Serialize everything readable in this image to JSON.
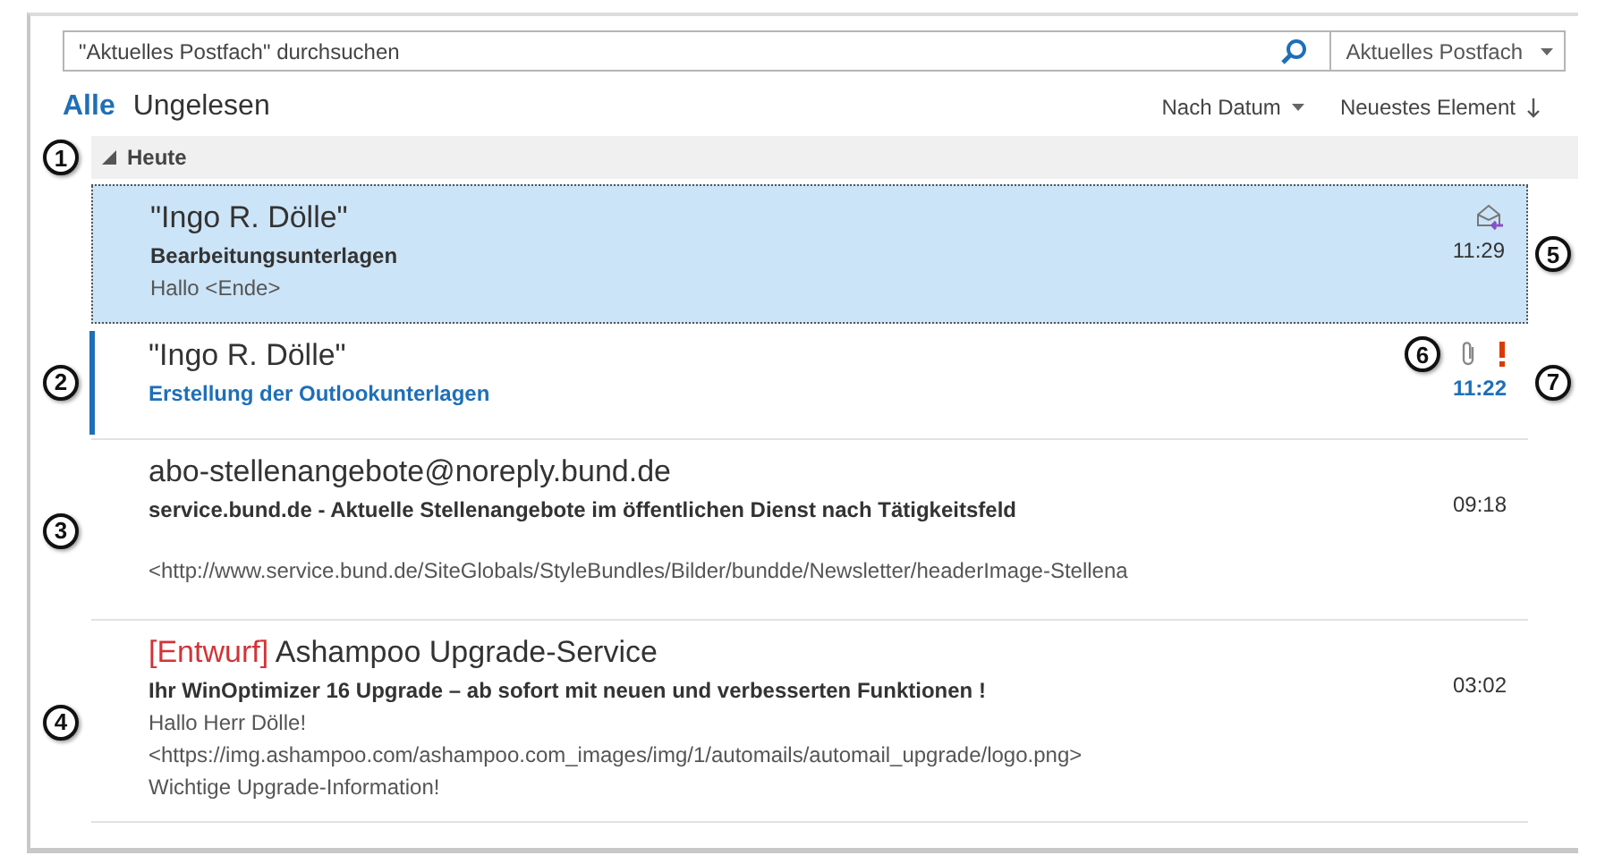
{
  "search": {
    "placeholder": "\"Aktuelles Postfach\" durchsuchen",
    "scope": "Aktuelles Postfach"
  },
  "filters": [
    {
      "label": "Alle",
      "selected": true
    },
    {
      "label": "Ungelesen",
      "selected": false
    }
  ],
  "sort": {
    "by": "Nach Datum",
    "order": "Neuestes Element"
  },
  "group": {
    "label": "Heute",
    "expanded": true,
    "callout": "1"
  },
  "mails": [
    {
      "sender": "\"Ingo R. Dölle\"",
      "subject": "Bearbeitungsunterlagen",
      "preview": [
        "Hallo <Ende>"
      ],
      "time": "11:29",
      "selected": true,
      "unread": false,
      "replied": true,
      "right_callout": "5"
    },
    {
      "sender": "\"Ingo R. Dölle\"",
      "subject": "Erstellung der Outlookunterlagen",
      "time": "11:22",
      "selected": false,
      "unread": true,
      "attachment": true,
      "important": true,
      "left_callout": "2",
      "attachment_callout": "6",
      "right_callout": "7"
    },
    {
      "sender": "abo-stellenangebote@noreply.bund.de",
      "subject": "service.bund.de - Aktuelle Stellenangebote im öffentlichen Dienst nach Tätigkeitsfeld",
      "preview": [
        "<http://www.service.bund.de/SiteGlobals/StyleBundles/Bilder/bundde/Newsletter/headerImage-Stellena"
      ],
      "preview_spaced": true,
      "time": "09:18",
      "selected": false,
      "unread": false,
      "left_callout": "3"
    },
    {
      "draft_label": "[Entwurf]",
      "sender": "Ashampoo Upgrade-Service",
      "subject": "Ihr WinOptimizer 16 Upgrade – ab sofort mit neuen und verbesserten Funktionen !",
      "preview": [
        "Hallo Herr Dölle!",
        " <https://img.ashampoo.com/ashampoo.com_images/img/1/automails/automail_upgrade/logo.png>",
        "Wichtige Upgrade-Information!"
      ],
      "time": "03:02",
      "selected": false,
      "unread": false,
      "left_callout": "4"
    }
  ]
}
